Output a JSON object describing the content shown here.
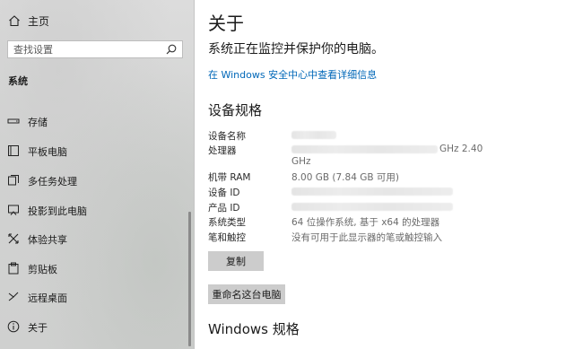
{
  "sidebar": {
    "home_label": "主页",
    "search_placeholder": "查找设置",
    "section_heading": "系统",
    "items": [
      {
        "label": "存储",
        "icon": "storage-icon"
      },
      {
        "label": "平板电脑",
        "icon": "tablet-icon"
      },
      {
        "label": "多任务处理",
        "icon": "multitasking-icon"
      },
      {
        "label": "投影到此电脑",
        "icon": "projection-icon"
      },
      {
        "label": "体验共享",
        "icon": "shared-experiences-icon"
      },
      {
        "label": "剪贴板",
        "icon": "clipboard-icon"
      },
      {
        "label": "远程桌面",
        "icon": "remote-desktop-icon"
      },
      {
        "label": "关于",
        "icon": "info-icon"
      }
    ]
  },
  "main": {
    "title": "关于",
    "status_text": "系统正在监控并保护你的电脑。",
    "security_link": "在 Windows 安全中心中查看详细信息",
    "device_specs": {
      "heading": "设备规格",
      "rows": [
        {
          "label": "设备名称",
          "value": ""
        },
        {
          "label": "处理器",
          "value": "GHz   2.40",
          "value_line2": "GHz"
        },
        {
          "label": "机带 RAM",
          "value": "8.00 GB (7.84 GB 可用)"
        },
        {
          "label": "设备 ID",
          "value": ""
        },
        {
          "label": "产品 ID",
          "value": ""
        },
        {
          "label": "系统类型",
          "value": "64 位操作系统, 基于 x64 的处理器"
        },
        {
          "label": "笔和触控",
          "value": "没有可用于此显示器的笔或触控输入"
        }
      ],
      "copy_button": "复制",
      "rename_button": "重命名这台电脑"
    },
    "windows_specs_heading": "Windows 规格"
  },
  "colors": {
    "link": "#0067b8",
    "button_bg": "#cccccc",
    "sidebar_bg": "#d6d6d6"
  }
}
